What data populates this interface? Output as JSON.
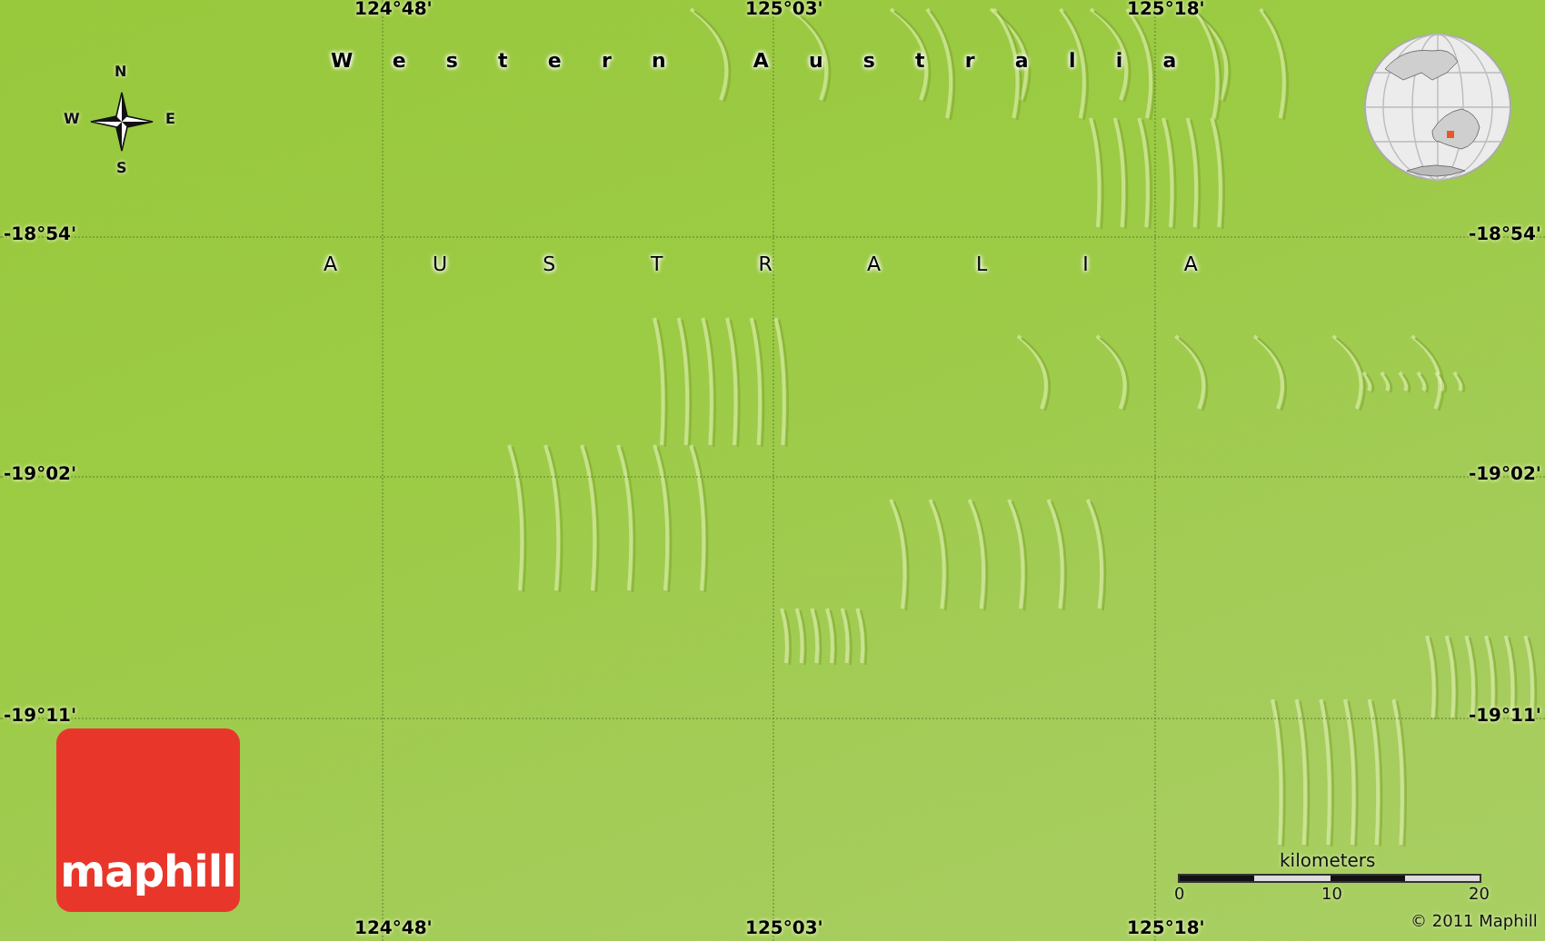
{
  "map": {
    "longitude_labels_top": [
      "124°48'",
      "125°03'",
      "125°18'"
    ],
    "longitude_labels_bottom": [
      "124°48'",
      "125°03'",
      "125°18'"
    ],
    "latitude_labels_left": [
      "-18°54'",
      "-19°02'",
      "-19°11'"
    ],
    "latitude_labels_right": [
      "-18°54'",
      "-19°02'",
      "-19°11'"
    ],
    "region_labels": [
      {
        "text": "Western Australia",
        "kind": "state"
      },
      {
        "text": "AUSTRALIA",
        "kind": "country"
      }
    ],
    "compass": {
      "north": "N",
      "south": "S",
      "east": "E",
      "west": "W"
    },
    "logo": "maphill",
    "scale": {
      "unit": "kilometers",
      "ticks": [
        "0",
        "10",
        "20"
      ]
    },
    "copyright": "© 2011 Maphill"
  }
}
